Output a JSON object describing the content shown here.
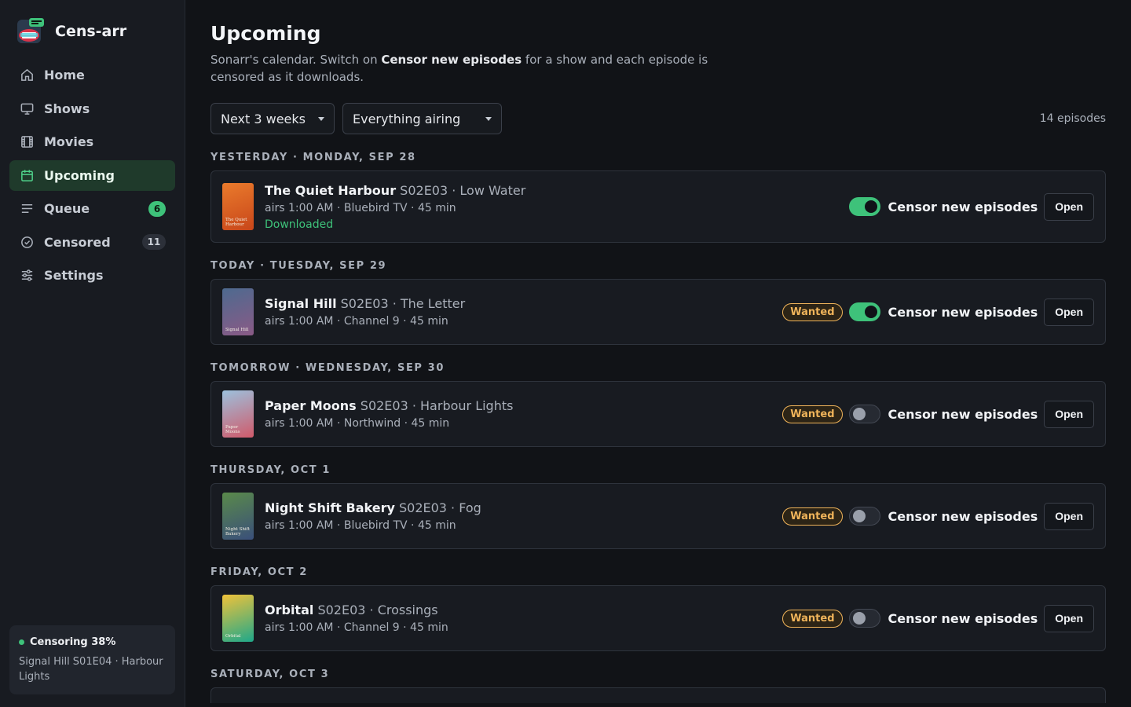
{
  "app": {
    "name": "Cens-arr"
  },
  "sidebar": {
    "items": [
      {
        "label": "Home",
        "icon": "home-icon",
        "active": false
      },
      {
        "label": "Shows",
        "icon": "monitor-icon",
        "active": false
      },
      {
        "label": "Movies",
        "icon": "film-icon",
        "active": false
      },
      {
        "label": "Upcoming",
        "icon": "calendar-icon",
        "active": true
      },
      {
        "label": "Queue",
        "icon": "queue-icon",
        "active": false,
        "badge": "6"
      },
      {
        "label": "Censored",
        "icon": "check-circle-icon",
        "active": false,
        "badge": "11"
      },
      {
        "label": "Settings",
        "icon": "sliders-icon",
        "active": false
      }
    ],
    "status": {
      "title": "Censoring 38%",
      "subtitle": "Signal Hill S01E04 · Harbour Lights",
      "progress": 38
    }
  },
  "page": {
    "title": "Upcoming",
    "desc_pre": "Sonarr's calendar. Switch on ",
    "desc_bold": "Censor new episodes",
    "desc_post": " for a show and each episode is censored as it downloads."
  },
  "filters": {
    "range": "Next 3 weeks",
    "scope": "Everything airing",
    "count": "14 episodes"
  },
  "toggle_label": "Censor new episodes",
  "open_label": "Open",
  "wanted_label": "Wanted",
  "days": [
    {
      "label": "Yesterday · Monday, Sep 28",
      "episodes": [
        {
          "show": "The Quiet Harbour",
          "episode": "S02E03 · Low Water",
          "meta": "airs 1:00 AM · Bluebird TV · 45 min",
          "status": "Downloaded",
          "wanted": false,
          "censor": true,
          "poster_text": "The Quiet Harbour",
          "poster_colors": [
            "#ea7b2c",
            "#c8461a"
          ]
        }
      ]
    },
    {
      "label": "Today · Tuesday, Sep 29",
      "episodes": [
        {
          "show": "Signal Hill",
          "episode": "S02E03 · The Letter",
          "meta": "airs 1:00 AM · Channel 9 · 45 min",
          "status": "",
          "wanted": true,
          "censor": true,
          "poster_text": "Signal Hill",
          "poster_colors": [
            "#4d6a8f",
            "#8a5a86"
          ]
        }
      ]
    },
    {
      "label": "Tomorrow · Wednesday, Sep 30",
      "episodes": [
        {
          "show": "Paper Moons",
          "episode": "S02E03 · Harbour Lights",
          "meta": "airs 1:00 AM · Northwind · 45 min",
          "status": "",
          "wanted": true,
          "censor": false,
          "poster_text": "Paper Moons",
          "poster_colors": [
            "#9cc1dd",
            "#d05a6a"
          ]
        }
      ]
    },
    {
      "label": "Thursday, Oct 1",
      "episodes": [
        {
          "show": "Night Shift Bakery",
          "episode": "S02E03 · Fog",
          "meta": "airs 1:00 AM · Bluebird TV · 45 min",
          "status": "",
          "wanted": true,
          "censor": false,
          "poster_text": "Night Shift Bakery",
          "poster_colors": [
            "#5a8a4a",
            "#3a4f7a"
          ]
        }
      ]
    },
    {
      "label": "Friday, Oct 2",
      "episodes": [
        {
          "show": "Orbital",
          "episode": "S02E03 · Crossings",
          "meta": "airs 1:00 AM · Channel 9 · 45 min",
          "status": "",
          "wanted": true,
          "censor": false,
          "poster_text": "Orbital",
          "poster_colors": [
            "#f0c23a",
            "#1fa88a"
          ]
        }
      ]
    },
    {
      "label": "Saturday, Oct 3",
      "episodes": []
    }
  ],
  "colors": {
    "accent": "#3ec27a",
    "wanted": "#f0b45a",
    "background": "#111317"
  }
}
